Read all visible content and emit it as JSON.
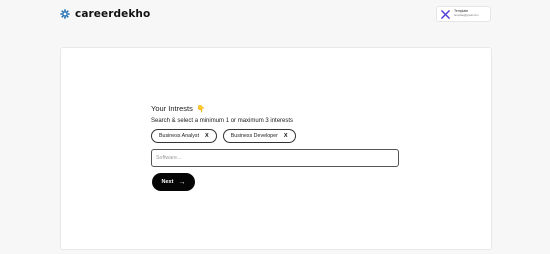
{
  "header": {
    "brand": "careerdekho",
    "brand_color": "#1f6fb2",
    "logo_icon": "snowflake-logo-icon",
    "user": {
      "name": "Template",
      "email": "template@gmail.com",
      "avatar_icon": "user-avatar-icon",
      "accent": "#4b3bd6"
    }
  },
  "interests": {
    "title": "Your Intrests",
    "title_emoji": "👇",
    "subtitle": "Search & select a minimum 1 or maximum 3 interests",
    "selected": [
      {
        "label": "Business Analyst",
        "remove": "X"
      },
      {
        "label": "Business Developer",
        "remove": "X"
      }
    ],
    "search_placeholder": "Software...",
    "search_value": "",
    "next_label": "Next",
    "next_icon": "arrow-right-icon"
  }
}
